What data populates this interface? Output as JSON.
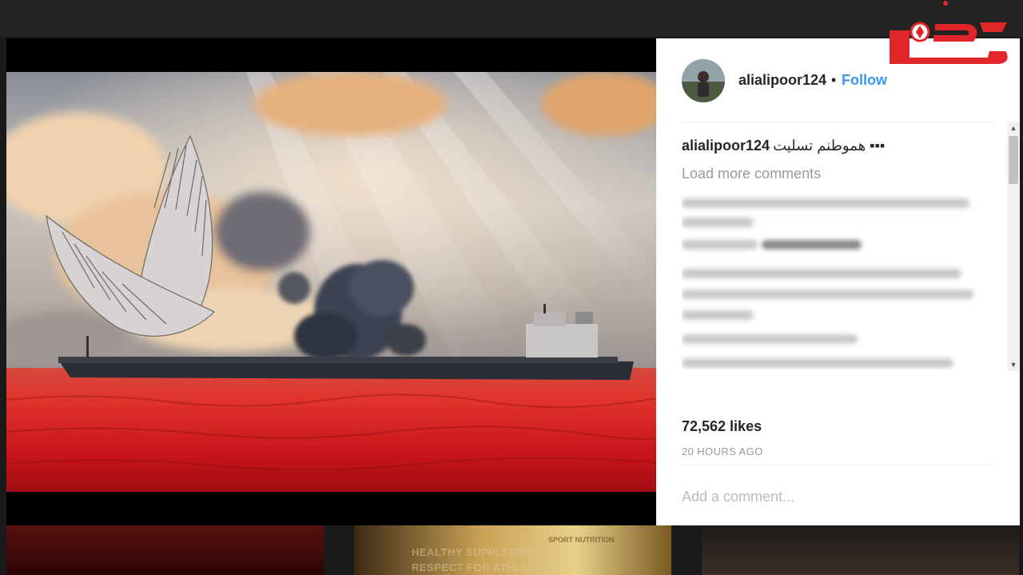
{
  "post": {
    "username": "alialipoor124",
    "follow_label": "Follow",
    "separator": "•",
    "caption_user": "alialipoor124",
    "caption_text": "هموطنم تسلیت ▪▪▪",
    "load_more": "Load more comments",
    "likes": "72,562 likes",
    "time_ago": "20 HOURS AGO",
    "add_comment_placeholder": "Add a comment..."
  },
  "background": {
    "ad_line1": "HEALTHY SUPPLEMENT",
    "ad_line2": "RESPECT FOR ATHLETES",
    "ad_brand": "SPORT NUTRITION"
  },
  "colors": {
    "link": "#3897f0",
    "text": "#262626",
    "muted": "#999999",
    "logo_red": "#e0262b"
  },
  "icons": {
    "scroll_up": "scroll-up-arrow-icon",
    "scroll_down": "scroll-down-arrow-icon"
  }
}
